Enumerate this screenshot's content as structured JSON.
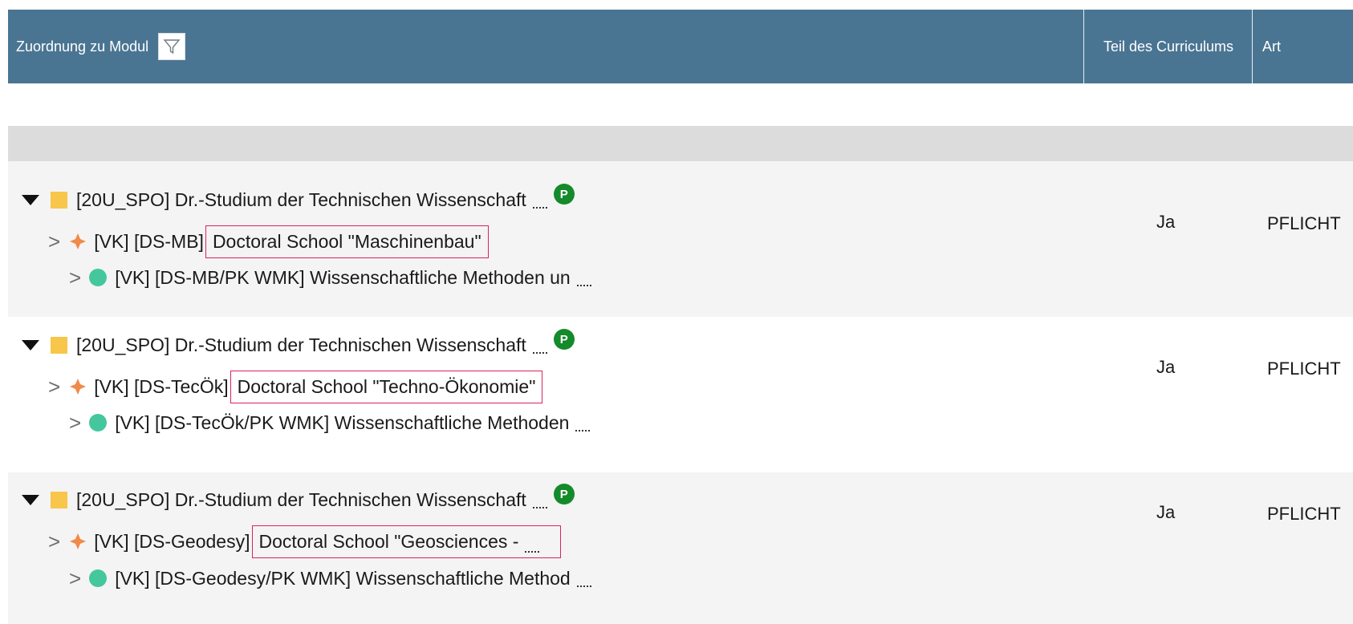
{
  "header": {
    "col_module": "Zuordnung zu Modul",
    "col_curriculum": "Teil des Curriculums",
    "col_type": "Art"
  },
  "icons": {
    "filter": "filter-icon",
    "expand": "caret-down-icon",
    "collapsed": "chevron-right-icon",
    "study_program": "yellow-square-icon",
    "module_group": "orange-diamond-icon",
    "module": "green-circle-icon",
    "more": "ellipsis-icon",
    "badge": "p-badge-icon"
  },
  "colors": {
    "header_bg": "#4a7592",
    "highlight_border": "#d9245a",
    "badge_green": "#148a2b",
    "square_yellow": "#f7c64a",
    "diamond_orange": "#ef8a4a",
    "circle_green": "#44c79d"
  },
  "rows": [
    {
      "program": "[20U_SPO] Dr.-Studium der Technischen Wissenschaft",
      "badge": "P",
      "group_prefix": "[VK] [DS-MB]",
      "group_name": "Doctoral School \"Maschinenbau\"",
      "module": "[VK] [DS-MB/PK WMK] Wissenschaftliche Methoden un",
      "curriculum": "Ja",
      "type": "PFLICHT"
    },
    {
      "program": "[20U_SPO] Dr.-Studium der Technischen Wissenschaft",
      "badge": "P",
      "group_prefix": "[VK] [DS-TecÖk]",
      "group_name": "Doctoral School \"Techno-Ökonomie\"",
      "module": "[VK] [DS-TecÖk/PK WMK] Wissenschaftliche Methoden",
      "curriculum": "Ja",
      "type": "PFLICHT"
    },
    {
      "program": "[20U_SPO] Dr.-Studium der Technischen Wissenschaft",
      "badge": "P",
      "group_prefix": "[VK] [DS-Geodesy]",
      "group_name": "Doctoral School \"Geosciences -",
      "module": "[VK] [DS-Geodesy/PK WMK] Wissenschaftliche Method",
      "curriculum": "Ja",
      "type": "PFLICHT"
    }
  ]
}
